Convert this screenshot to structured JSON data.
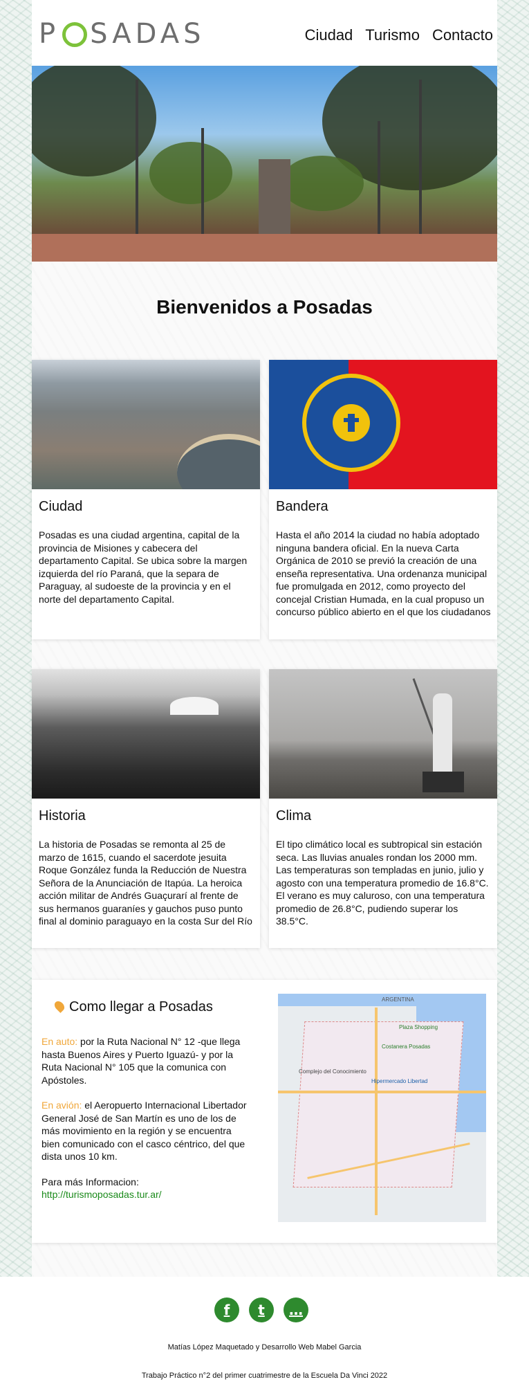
{
  "header": {
    "logo": "POSADAS",
    "nav": [
      "Ciudad",
      "Turismo",
      "Contacto"
    ]
  },
  "welcome": "Bienvenidos a Posadas",
  "cards": [
    {
      "title": "Ciudad",
      "text": "Posadas es una ciudad argentina, capital de la provincia de Misiones y cabecera del departamento Capital. Se ubica sobre la margen izquierda del río Paraná, que la separa de Paraguay, al sudoeste de la provincia y en el norte del departamento Capital."
    },
    {
      "title": "Bandera",
      "text": "Hasta el año 2014 la ciudad no había adoptado ninguna bandera oficial. En la nueva Carta Orgánica de 2010 se previó la creación de una enseña representativa. Una ordenanza municipal fue promulgada en 2012, como proyecto del concejal Cristian Humada, en la cual propuso un concurso público abierto en el que los ciudadanos"
    },
    {
      "title": "Historia",
      "text": "La historia de Posadas se remonta al 25 de marzo de 1615, cuando el sacerdote jesuita Roque González funda la Reducción de Nuestra Señora de la Anunciación de Itapúa. La heroica acción militar de Andrés Guaçurarí al frente de sus hermanos guaraníes y gauchos puso punto final al dominio paraguayo en la costa Sur del Río"
    },
    {
      "title": "Clima",
      "text1": "El tipo climático local es subtropical sin estación seca. Las lluvias anuales rondan los 2000 mm.",
      "text2": "Las temperaturas son templadas en junio, julio y agosto con una temperatura promedio de 16.8°C. El verano es muy caluroso,  con una temperatura promedio de 26.8°C, pudiendo superar los 38.5°C."
    }
  ],
  "howto": {
    "title": "Como llegar a Posadas",
    "auto_label": "En auto:",
    "auto_text": " por la Ruta Nacional N° 12 -que llega hasta Buenos Aires y Puerto Iguazú- y por la Ruta Nacional N° 105 que la comunica con Apóstoles.",
    "avion_label": "En avión:",
    "avion_text": " el Aeropuerto Internacional Libertador General José de San Martín es uno de los de más movimiento en la región y se encuentra bien comunicado con el casco céntrico, del que dista unos 10 km.",
    "info_label": "Para más Informacion:",
    "info_link": "http://turismoposadas.tur.ar/",
    "map_labels": {
      "country": "ARGENTINA",
      "plaza": "Plaza Shopping",
      "costanera": "Costanera Posadas",
      "hiper": "Hipermercado Libertad",
      "complejo": "Complejo del Conocimiento"
    }
  },
  "footer": {
    "social_icons": [
      "facebook-icon",
      "twitter-icon",
      "chat-icon"
    ],
    "social_glyphs": [
      "f",
      "t",
      "…"
    ],
    "line1": "Matías López Maquetado y Desarrollo Web Mabel Garcia",
    "line2": "Trabajo Práctico n°2 del primer cuatrimestre de la Escuela Da Vinci 2022"
  },
  "colors": {
    "accent_green": "#7dc23a",
    "link_green": "#1a8a1a",
    "highlight_orange": "#f0a73a",
    "flag_blue": "#1b4f9c",
    "flag_red": "#e3141f"
  }
}
